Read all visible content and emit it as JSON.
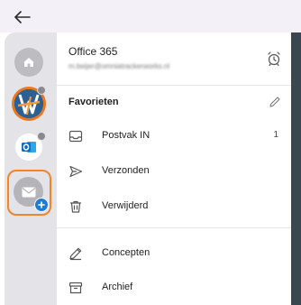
{
  "account": {
    "name": "Office 365",
    "email": "m.beijer@omniatrackerworks.nl"
  },
  "favorites": {
    "title": "Favorieten"
  },
  "folders": [
    {
      "label": "Postvak IN",
      "count": "1",
      "icon": "inbox-icon"
    },
    {
      "label": "Verzonden",
      "icon": "send-icon"
    },
    {
      "label": "Verwijderd",
      "icon": "trash-icon"
    },
    {
      "label": "Concepten",
      "icon": "draft-icon"
    },
    {
      "label": "Archief",
      "icon": "archive-icon"
    }
  ],
  "colors": {
    "accent": "#f0852b",
    "badge": "#1f7bd6",
    "outlook": "#0f6cbd"
  }
}
